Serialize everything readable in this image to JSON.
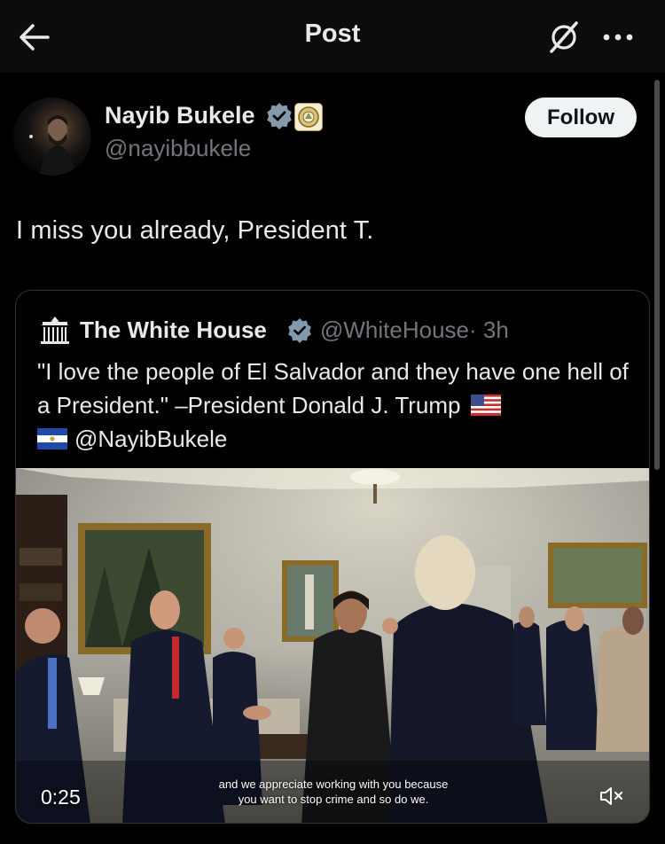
{
  "header": {
    "title": "Post",
    "back_icon": "arrow-left-icon",
    "grok_icon": "grok-icon",
    "more_icon": "more-horizontal-icon"
  },
  "post": {
    "author_name": "Nayib Bukele",
    "handle": "@nayibbukele",
    "follow_label": "Follow",
    "text": "I miss you already, President T.",
    "verified_color": "#829aab"
  },
  "quote": {
    "author_name": "The White House",
    "handle": "@WhiteHouse",
    "time": "· 3h",
    "text_line1": "\"I love the people of El Salvador and they have one hell of a President.\" –President Donald J. Trump",
    "mention": "@NayibBukele",
    "flags": [
      "us-flag-icon",
      "el-salvador-flag-icon"
    ]
  },
  "video": {
    "timestamp": "0:25",
    "caption_line1": "and we appreciate working with you because",
    "caption_line2": "you want to stop crime and so do we.",
    "mute_icon": "volume-muted-icon"
  },
  "colors": {
    "background": "#000000",
    "text": "#e7e9ea",
    "secondary_text": "#71767b",
    "border": "#2f3336",
    "follow_bg": "#eff3f4"
  }
}
